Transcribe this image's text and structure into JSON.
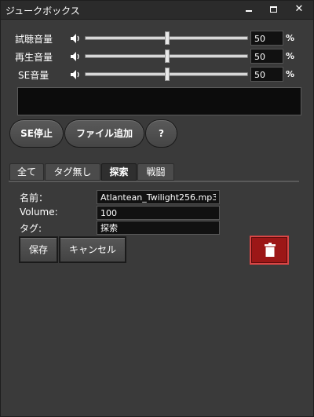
{
  "window": {
    "title": "ジュークボックス",
    "minimize_label": "_",
    "maximize_label": "□",
    "close_label": "✕"
  },
  "volumes": [
    {
      "label": "試聴音量",
      "value": "50",
      "unit": "%",
      "level": 0.5
    },
    {
      "label": "再生音量",
      "value": "50",
      "unit": "%",
      "level": 0.5
    },
    {
      "label": "SE音量",
      "value": "50",
      "unit": "%",
      "level": 0.5
    }
  ],
  "buttons": {
    "se_stop": "SE停止",
    "add_file": "ファイル追加",
    "help": "?"
  },
  "tabs": [
    {
      "label": "全て",
      "active": false
    },
    {
      "label": "タグ無し",
      "active": false
    },
    {
      "label": "探索",
      "active": true
    },
    {
      "label": "戦闘",
      "active": false
    }
  ],
  "form": {
    "name_label": "名前：",
    "name_value": "Atlantean_Twilight256.mp3",
    "volume_label": "Volume:",
    "volume_value": "100",
    "tag_label": "タグ:",
    "tag_value": "探索",
    "save_label": "保存",
    "cancel_label": "キャンセル"
  },
  "colors": {
    "accent_delete": "#9c1717",
    "background": "#3a3a3a"
  },
  "icons": [
    "speaker-icon",
    "trash-icon"
  ]
}
